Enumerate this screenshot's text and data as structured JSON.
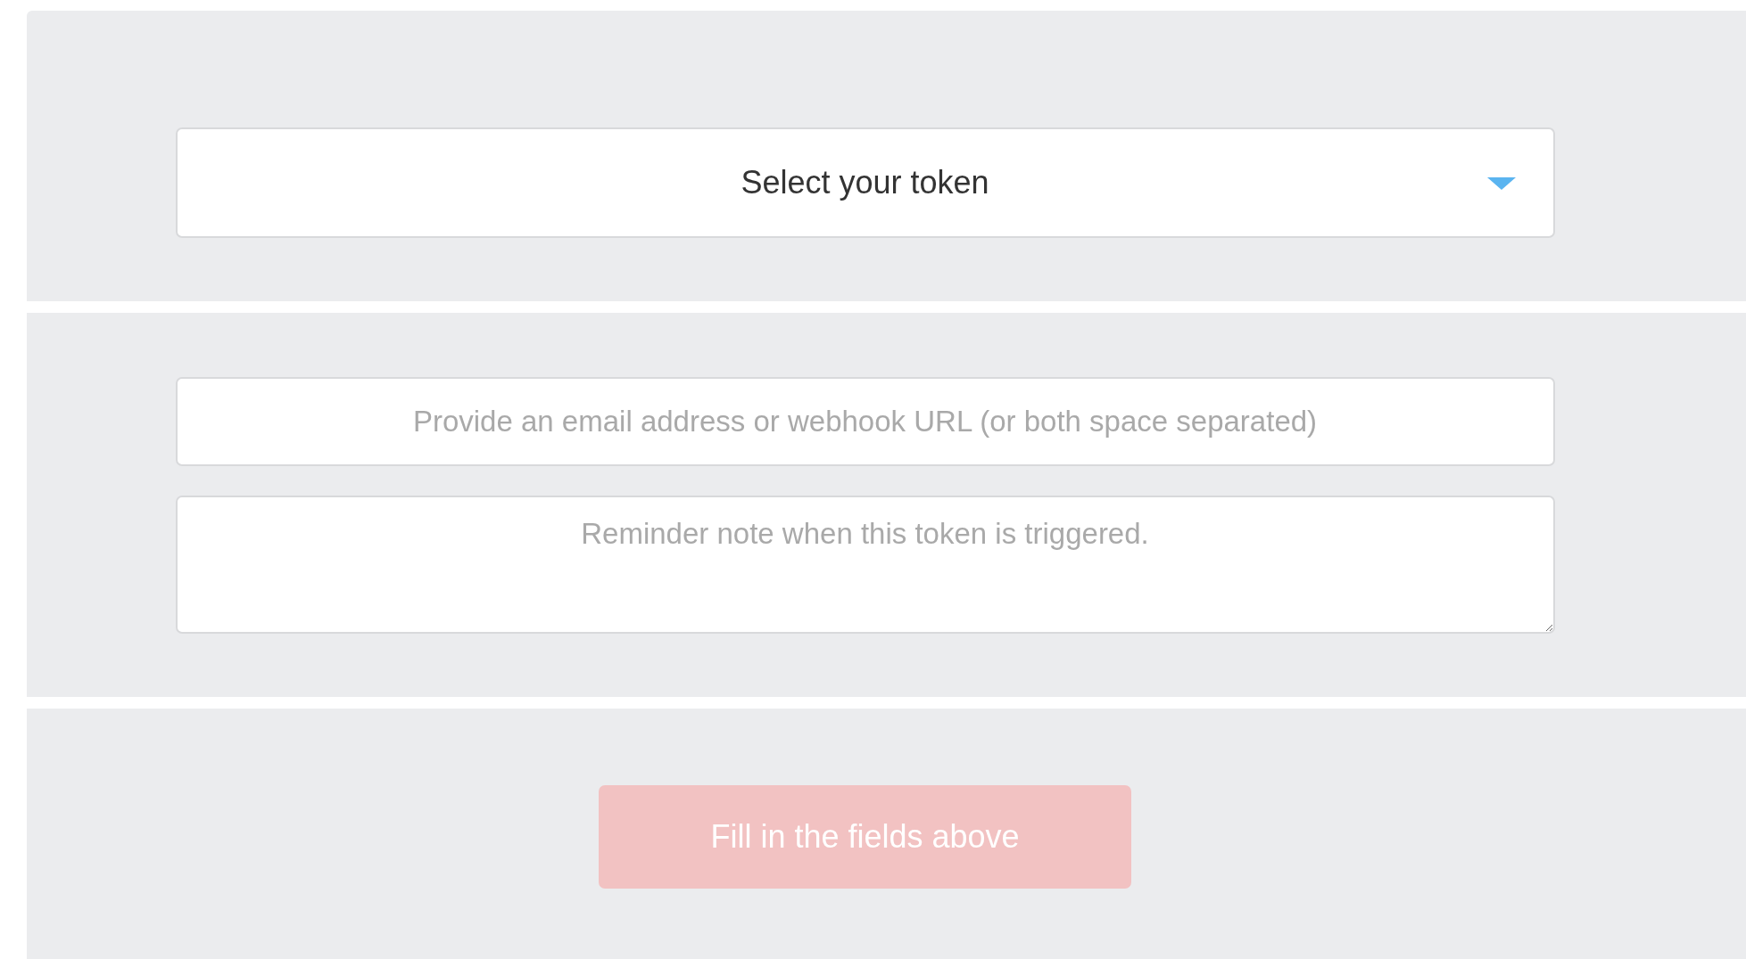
{
  "token_select": {
    "label": "Select your token"
  },
  "alert_field": {
    "placeholder": "Provide an email address or webhook URL (or both space separated)"
  },
  "note_field": {
    "placeholder": "Reminder note when this token is triggered."
  },
  "submit_button": {
    "label": "Fill in the fields above",
    "disabled": true
  }
}
